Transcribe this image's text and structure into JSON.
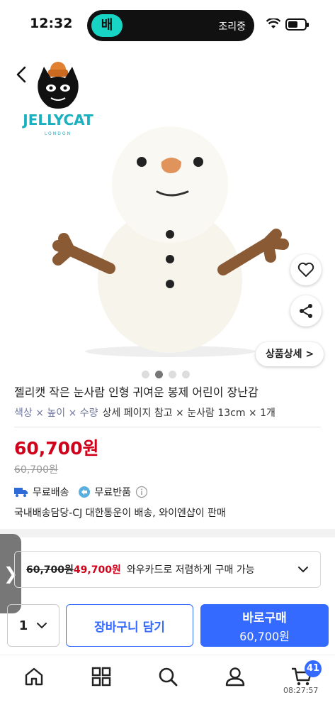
{
  "status_bar": {
    "time": "12:32",
    "island_app": "배",
    "island_text": "조리중"
  },
  "product": {
    "logo_text": "JELLYCAT",
    "logo_sub": "LONDON",
    "detail_button": "상품상세 >",
    "title": "젤리캣 작은 눈사람 인형 귀여운 봉제 어린이 장난감",
    "options_label": "색상 × 높이 × 수량",
    "options_value": "상세 페이지 참고 × 눈사람 13cm × 1개",
    "price": "60,700원",
    "original_price": "60,700원",
    "free_shipping": "무료배송",
    "free_return": "무료반품",
    "seller": "국내배송담당-CJ 대한통운이 배송, 와이엔샵이 판매"
  },
  "coupon": {
    "strike_price": "60,700원",
    "sale_price": "49,700원",
    "text": "와우카드로 저렴하게 구매 가능"
  },
  "actions": {
    "quantity": "1",
    "cart_label": "장바구니 담기",
    "buy_label": "바로구매",
    "buy_price": "60,700원"
  },
  "nav": {
    "cart_count": "41",
    "clock": "08:27:57"
  },
  "colors": {
    "accent": "#346aff",
    "price_red": "#d0021b"
  }
}
